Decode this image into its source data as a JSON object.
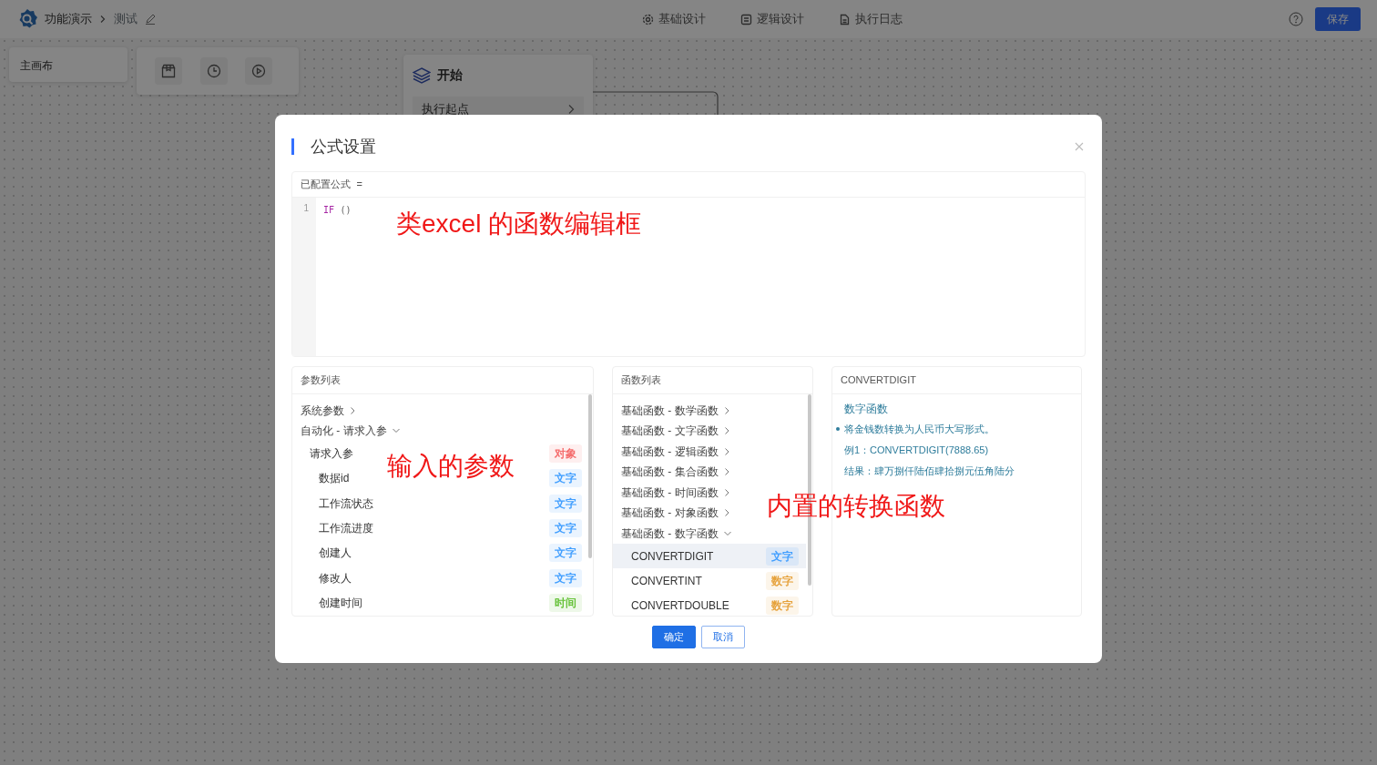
{
  "header": {
    "app_name": "功能演示",
    "breadcrumb": "测试",
    "nav": [
      {
        "label": "基础设计"
      },
      {
        "label": "逻辑设计"
      },
      {
        "label": "执行日志"
      }
    ],
    "save": "保存"
  },
  "canvas": {
    "panel": "主画布",
    "node": {
      "title": "开始",
      "row": "执行起点"
    }
  },
  "modal": {
    "title": "公式设置",
    "editor": {
      "label": "已配置公式",
      "operator": "=",
      "lines": [
        {
          "number": "1",
          "tokens": [
            {
              "text": "IF",
              "kind": "keyword"
            },
            {
              "text": "()",
              "kind": "plain"
            }
          ]
        }
      ]
    },
    "params": {
      "title": "参数列表",
      "items": [
        {
          "label": "系统参数",
          "expanded": false
        },
        {
          "label": "自动化 - 请求入参",
          "expanded": true,
          "children": [
            {
              "label": "请求入参",
              "tag": "对象",
              "color": "#f56c6c",
              "children": [
                {
                  "label": "数据id",
                  "tag": "文字",
                  "color": "#409eff"
                },
                {
                  "label": "工作流状态",
                  "tag": "文字",
                  "color": "#409eff"
                },
                {
                  "label": "工作流进度",
                  "tag": "文字",
                  "color": "#409eff"
                },
                {
                  "label": "创建人",
                  "tag": "文字",
                  "color": "#409eff"
                },
                {
                  "label": "修改人",
                  "tag": "文字",
                  "color": "#409eff"
                },
                {
                  "label": "创建时间",
                  "tag": "时间",
                  "color": "#67c23a"
                }
              ]
            }
          ]
        }
      ]
    },
    "functions": {
      "title": "函数列表",
      "items": [
        {
          "label": "基础函数 - 数学函数",
          "expanded": false
        },
        {
          "label": "基础函数 - 文字函数",
          "expanded": false
        },
        {
          "label": "基础函数 - 逻辑函数",
          "expanded": false
        },
        {
          "label": "基础函数 - 集合函数",
          "expanded": false
        },
        {
          "label": "基础函数 - 时间函数",
          "expanded": false
        },
        {
          "label": "基础函数 - 对象函数",
          "expanded": false
        },
        {
          "label": "基础函数 - 数字函数",
          "expanded": true,
          "children": [
            {
              "label": "CONVERTDIGIT",
              "tag": "文字",
              "color": "#409eff",
              "selected": true
            },
            {
              "label": "CONVERTINT",
              "tag": "数字",
              "color": "#e6a23c",
              "selected": false
            },
            {
              "label": "CONVERTDOUBLE",
              "tag": "数字",
              "color": "#e6a23c",
              "selected": false
            }
          ]
        }
      ]
    },
    "detail": {
      "title": "CONVERTDIGIT",
      "category": "数字函数",
      "description": "将金钱数转换为人民币大写形式。",
      "example": "例1：CONVERTDIGIT(7888.65)",
      "result": "结果：肆万捌仟陆佰肆拾捌元伍角陆分"
    },
    "buttons": [
      {
        "label": "确定",
        "kind": "primary"
      },
      {
        "label": "取消",
        "kind": "secondary"
      }
    ]
  },
  "annotations": [
    {
      "text": "类excel 的函数编辑框"
    },
    {
      "text": "输入的参数"
    },
    {
      "text": "内置的转换函数"
    }
  ]
}
